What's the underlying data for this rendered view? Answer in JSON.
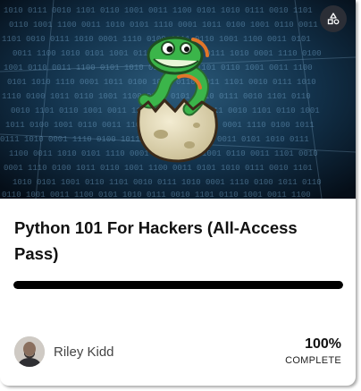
{
  "course": {
    "title": "Python 101 For Hackers (All-Access Pass)",
    "progress_fraction": 1.0
  },
  "instructor": {
    "name": "Riley Kidd"
  },
  "completion": {
    "value": "100%",
    "label": "COMPLETE"
  },
  "icons": {
    "corner_button": "shapes-icon",
    "banner_logo": "snake-egg-logo"
  },
  "colors": {
    "banner_bg": "#0a1a2a",
    "progress": "#000000",
    "snake_green": "#3bb54a",
    "egg": "#e8e0c4"
  }
}
